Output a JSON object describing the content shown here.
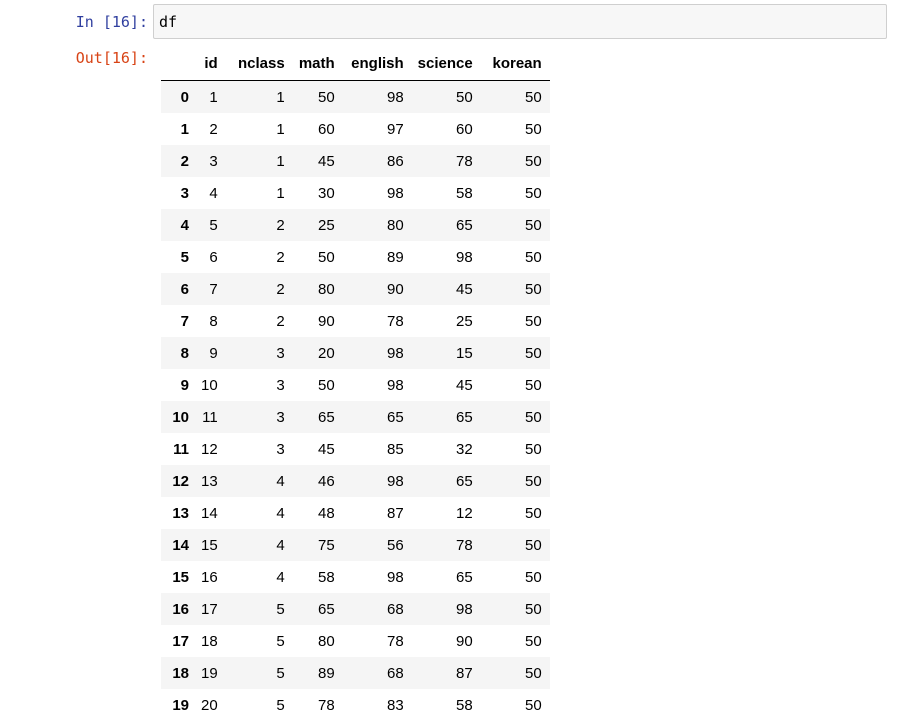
{
  "input_cell": {
    "prompt": "In [16]:",
    "code": "df"
  },
  "output_cell": {
    "prompt": "Out[16]:"
  },
  "table": {
    "columns": [
      "",
      "id",
      "nclass",
      "math",
      "english",
      "science",
      "korean"
    ],
    "rows": [
      [
        "0",
        "1",
        "1",
        "50",
        "98",
        "50",
        "50"
      ],
      [
        "1",
        "2",
        "1",
        "60",
        "97",
        "60",
        "50"
      ],
      [
        "2",
        "3",
        "1",
        "45",
        "86",
        "78",
        "50"
      ],
      [
        "3",
        "4",
        "1",
        "30",
        "98",
        "58",
        "50"
      ],
      [
        "4",
        "5",
        "2",
        "25",
        "80",
        "65",
        "50"
      ],
      [
        "5",
        "6",
        "2",
        "50",
        "89",
        "98",
        "50"
      ],
      [
        "6",
        "7",
        "2",
        "80",
        "90",
        "45",
        "50"
      ],
      [
        "7",
        "8",
        "2",
        "90",
        "78",
        "25",
        "50"
      ],
      [
        "8",
        "9",
        "3",
        "20",
        "98",
        "15",
        "50"
      ],
      [
        "9",
        "10",
        "3",
        "50",
        "98",
        "45",
        "50"
      ],
      [
        "10",
        "11",
        "3",
        "65",
        "65",
        "65",
        "50"
      ],
      [
        "11",
        "12",
        "3",
        "45",
        "85",
        "32",
        "50"
      ],
      [
        "12",
        "13",
        "4",
        "46",
        "98",
        "65",
        "50"
      ],
      [
        "13",
        "14",
        "4",
        "48",
        "87",
        "12",
        "50"
      ],
      [
        "14",
        "15",
        "4",
        "75",
        "56",
        "78",
        "50"
      ],
      [
        "15",
        "16",
        "4",
        "58",
        "98",
        "65",
        "50"
      ],
      [
        "16",
        "17",
        "5",
        "65",
        "68",
        "98",
        "50"
      ],
      [
        "17",
        "18",
        "5",
        "80",
        "78",
        "90",
        "50"
      ],
      [
        "18",
        "19",
        "5",
        "89",
        "68",
        "87",
        "50"
      ],
      [
        "19",
        "20",
        "5",
        "78",
        "83",
        "58",
        "50"
      ]
    ]
  },
  "colors": {
    "in_prompt": "#303f9f",
    "out_prompt": "#d84315",
    "input_background": "#f7f7f7",
    "input_border": "#cfcfcf",
    "row_stripe": "#f5f5f5"
  }
}
